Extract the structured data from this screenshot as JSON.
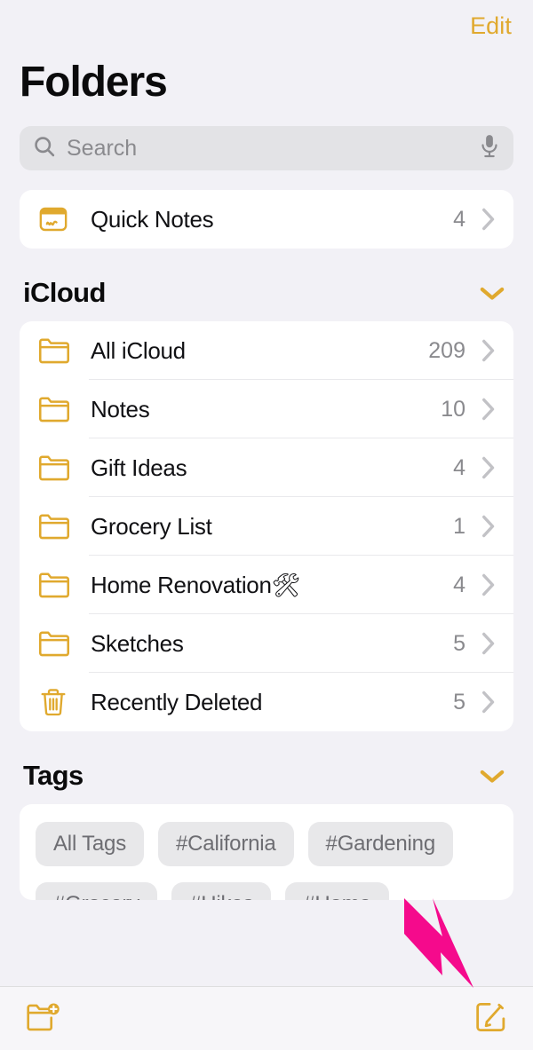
{
  "window": {
    "app": "Notes",
    "background_color": "#F2F1F6",
    "accent_color": "#E0A92E",
    "annotation_color": "#F50A8C"
  },
  "topbar": {
    "edit_label": "Edit"
  },
  "header": {
    "title": "Folders"
  },
  "search": {
    "placeholder": "Search",
    "value": "",
    "icon": "search-icon",
    "mic_icon": "microphone-icon"
  },
  "quick_notes": {
    "label": "Quick Notes",
    "count": "4",
    "icon": "quick-note-icon",
    "chevron": "chevron-right-icon"
  },
  "icloud_section": {
    "title": "iCloud",
    "collapse_icon": "chevron-down-icon",
    "folders": [
      {
        "label": "All iCloud",
        "count": "209",
        "icon": "folder-icon"
      },
      {
        "label": "Notes",
        "count": "10",
        "icon": "folder-icon"
      },
      {
        "label": "Gift Ideas",
        "count": "4",
        "icon": "folder-icon"
      },
      {
        "label": "Grocery List",
        "count": "1",
        "icon": "folder-icon"
      },
      {
        "label": "Home Renovation🛠",
        "count": "4",
        "icon": "folder-icon"
      },
      {
        "label": "Sketches",
        "count": "5",
        "icon": "folder-icon"
      },
      {
        "label": "Recently Deleted",
        "count": "5",
        "icon": "trash-icon"
      }
    ]
  },
  "tags_section": {
    "title": "Tags",
    "collapse_icon": "chevron-down-icon",
    "tags": [
      {
        "label": "All Tags"
      },
      {
        "label": "#California"
      },
      {
        "label": "#Gardening"
      },
      {
        "label": "#Grocery"
      },
      {
        "label": "#Hikes"
      },
      {
        "label": "#Home"
      }
    ]
  },
  "toolbar": {
    "new_folder_icon": "new-folder-icon",
    "compose_icon": "compose-icon"
  },
  "annotation": {
    "type": "arrow",
    "points_to": "compose-button"
  }
}
